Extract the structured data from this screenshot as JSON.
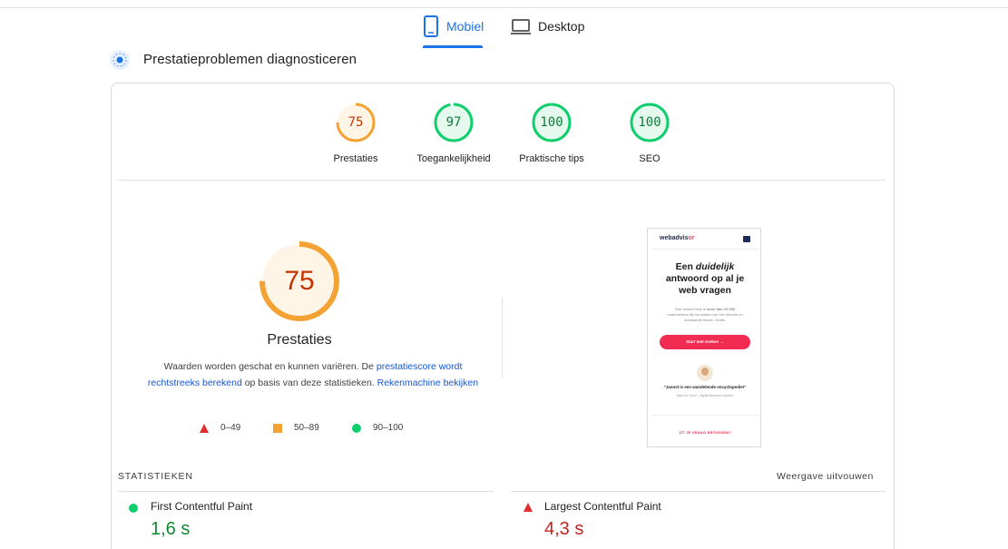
{
  "tabs": {
    "mobile": "Mobiel",
    "desktop": "Desktop"
  },
  "section_title": "Prestatieproblemen diagnosticeren",
  "scores": [
    {
      "label": "Prestaties",
      "value": 75,
      "color": "#fa3"
    },
    {
      "label": "Toegankelijkheid",
      "value": 97,
      "color": "#0cce6b"
    },
    {
      "label": "Praktische tips",
      "value": 100,
      "color": "#0cce6b"
    },
    {
      "label": "SEO",
      "value": 100,
      "color": "#0cce6b"
    }
  ],
  "main_gauge": {
    "value": 75,
    "title": "Prestaties"
  },
  "description": {
    "text1": "Waarden worden geschat en kunnen variëren. De ",
    "link1": "prestatiescore wordt rechtstreeks berekend",
    "text2": " op basis van deze statistieken. ",
    "link2": "Rekenmachine bekijken"
  },
  "legend": {
    "fail": "0–49",
    "average": "50–89",
    "pass": "90–100"
  },
  "phone": {
    "logo_a": "webadvis",
    "logo_b": "or",
    "heading_1": "Een ",
    "heading_em": "duidelijk",
    "heading_2": "antwoord op al je web vragen",
    "small_1": "Elke maand help ik ",
    "small_bold": "meer dan 10 000",
    "small_2": " ondernemers bij het maken van een slimme en doordachte keuze. Gratis.",
    "button": "Start met zoeken  →",
    "quote": "\"Jannel is een wandelende encyclopedie!\"",
    "who": "Mike De Hoon - Digital Business Advisor",
    "cta": "ZIT JE VRAAG ERTUSSEN?"
  },
  "stats": {
    "title": "STATISTIEKEN",
    "expand": "Weergave uitvouwen",
    "metrics": [
      {
        "name": "First Contentful Paint",
        "value": "1,6 s",
        "status": "pass",
        "color": "#0d8a2f"
      },
      {
        "name": "Largest Contentful Paint",
        "value": "4,3 s",
        "status": "fail",
        "color": "#c5221f"
      }
    ]
  }
}
